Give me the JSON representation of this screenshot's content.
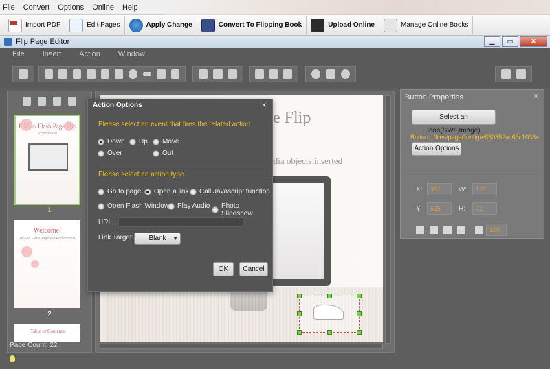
{
  "app_menu": [
    "File",
    "Convert",
    "Options",
    "Online",
    "Help"
  ],
  "toolbar": {
    "import_pdf": "Import PDF",
    "edit_pages": "Edit Pages",
    "apply_change": "Apply Change",
    "convert": "Convert To Flipping Book",
    "upload": "Upload Online",
    "manage": "Manage Online Books"
  },
  "editor": {
    "title": "Flip Page Editor",
    "menu": [
      "File",
      "Insert",
      "Action",
      "Window"
    ],
    "window_controls": {
      "minimize": "▁",
      "maximize": "▭",
      "close": "✕"
    }
  },
  "left_panel": {
    "thumb1_title": "PDF to Flash Page Flip",
    "thumb1_sub": "Professional",
    "thumb2_title": "Welcome!",
    "thumb2_sub": "PDF to Flash Page Flip Professional",
    "thumb3_title": "Table of Contents",
    "page_numbers": [
      "1",
      "2"
    ],
    "page_count": "Page Count: 22"
  },
  "canvas": {
    "title_line1": "ge Flip",
    "title_line2": "al",
    "subtitle": "ltimedia objects inserted"
  },
  "button_properties": {
    "title": "Button Properties",
    "close": "×",
    "select_icon": "Select an Icon(SWF,Image)",
    "path": "Button:../files/pageConfig/e850352ac65c1038e",
    "action_options": "Action Options",
    "x_label": "X:",
    "x_value": "387",
    "w_label": "W:",
    "w_value": "122",
    "y_label": "Y:",
    "y_value": "535",
    "h_label": "H:",
    "h_value": "72",
    "opacity_value": "100"
  },
  "action_dialog": {
    "title": "Action Options",
    "close": "×",
    "event_heading": "Please select an event that fires the related action.",
    "events": [
      "Down",
      "Up",
      "Move",
      "Over",
      "Out"
    ],
    "action_heading": "Please select an action type.",
    "actions": [
      "Go to page",
      "Open a link",
      "Call Javascript function",
      "Open Flash Window",
      "Play Audio",
      "Photo Slideshow"
    ],
    "url_label": "URL:",
    "url_value": "",
    "link_target_label": "Link Target:",
    "link_target_value": "Blank",
    "ok": "OK",
    "cancel": "Cancel"
  }
}
